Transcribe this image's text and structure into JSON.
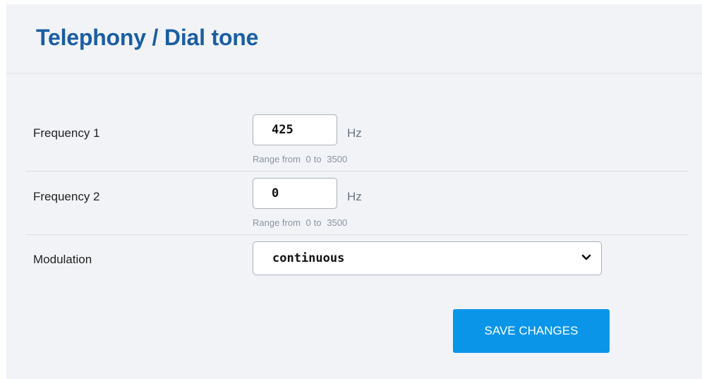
{
  "header": {
    "title": "Telephony / Dial tone"
  },
  "fields": {
    "frequency1": {
      "label": "Frequency 1",
      "value": "425",
      "unit": "Hz",
      "range_prefix": "Range from",
      "range_min": "0",
      "range_sep": "to",
      "range_max": "3500"
    },
    "frequency2": {
      "label": "Frequency 2",
      "value": "0",
      "unit": "Hz",
      "range_prefix": "Range from",
      "range_min": "0",
      "range_sep": "to",
      "range_max": "3500"
    },
    "modulation": {
      "label": "Modulation",
      "selected": "continuous"
    }
  },
  "actions": {
    "save_label": "SAVE CHANGES"
  },
  "colors": {
    "title": "#1a5ea2",
    "button": "#0a95e9",
    "background": "#f1f3f7"
  },
  "icons": {
    "select_arrow": "chevron-down-icon"
  }
}
